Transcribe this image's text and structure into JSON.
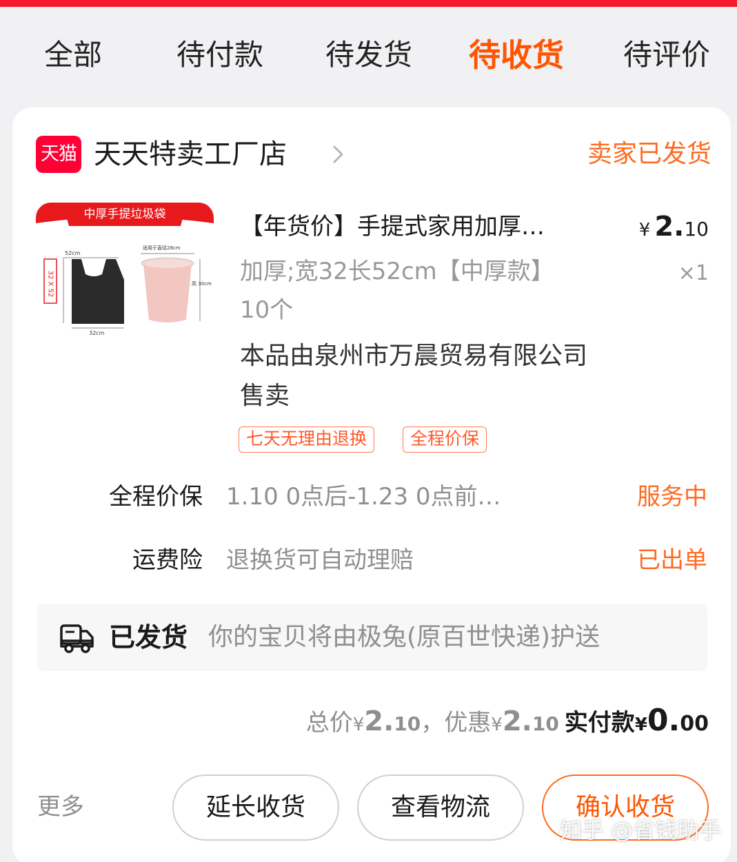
{
  "tabs": [
    {
      "label": "全部"
    },
    {
      "label": "待付款"
    },
    {
      "label": "待发货"
    },
    {
      "label": "待收货",
      "active": true
    },
    {
      "label": "待评价"
    }
  ],
  "accent_color": "#ff5500",
  "top_bar_color": "#f5192b",
  "order": {
    "platform_logo_text": "天猫",
    "shop_name": "天天特卖工厂店",
    "status": "卖家已发货",
    "product": {
      "image_icon": "garbage-bag-product-image",
      "image_banner": "中厚手提垃圾袋",
      "image_labels": {
        "height": "52cm",
        "size": "32 X 52",
        "width": "32cm",
        "bin_diameter": "适用于直径28cm",
        "bin_height": "高 30cm"
      },
      "title": "【年货价】手提式家用加厚…",
      "price_currency": "¥",
      "price_int": "2.",
      "price_dec": "10",
      "spec_line1": "加厚;宽32长52cm【中厚款】",
      "spec_line2": "10个",
      "quantity": "×1",
      "seller_line1": "本品由泉州市万晨贸易有限公司",
      "seller_line2": "售卖",
      "tags": [
        "七天无理由退换",
        "全程价保"
      ]
    },
    "services": [
      {
        "label": "全程价保",
        "desc": "1.10 0点后-1.23 0点前…",
        "status": "服务中"
      },
      {
        "label": "运费险",
        "desc": "退换货可自动理赔",
        "status": "已出单"
      }
    ],
    "shipping": {
      "icon": "truck-icon",
      "title": "已发货",
      "desc": "你的宝贝将由极兔(原百世快递)护送"
    },
    "summary": {
      "total_label": "总价",
      "total_yen": "¥",
      "total_int": "2.",
      "total_dec": "10",
      "separator": "，",
      "discount_label": "优惠",
      "discount_yen": "¥",
      "discount_int": "2.",
      "discount_dec": "10",
      "paid_label": "实付款",
      "paid_yen": "¥",
      "paid_int": "0.",
      "paid_dec": "00"
    },
    "actions": {
      "more": "更多",
      "extend": "延长收货",
      "logistics": "查看物流",
      "confirm": "确认收货"
    }
  },
  "watermark": "知乎 @省钱助手"
}
